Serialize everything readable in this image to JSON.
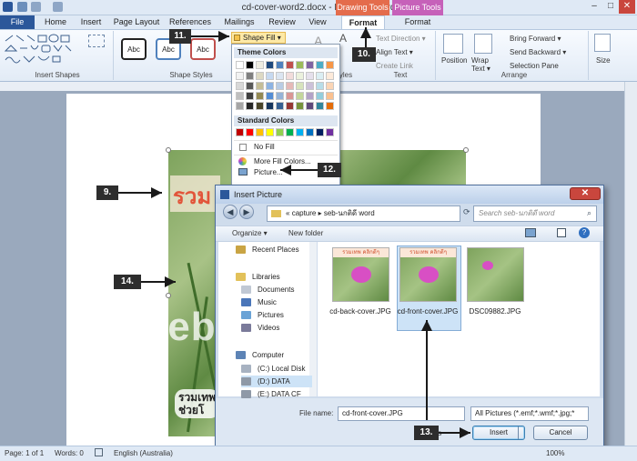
{
  "window": {
    "title": "cd-cover-word2.docx - Microsoft Word",
    "drawing_tools": "Drawing Tools",
    "picture_tools": "Picture Tools",
    "file_tab": "File",
    "tabs": [
      "Home",
      "Insert",
      "Page Layout",
      "References",
      "Mailings",
      "Review",
      "View"
    ],
    "format_tab_1": "Format",
    "format_tab_2": "Format"
  },
  "ribbon": {
    "shape_fill": "Shape Fill ▾",
    "text_direction": "Text Direction ▾",
    "align_text": "Align Text ▾",
    "create_link": "Create Link",
    "position": "Position",
    "wrap_text": "Wrap Text ▾",
    "bring_forward": "Bring Forward ▾",
    "send_backward": "Send Backward ▾",
    "selection_pane": "Selection Pane",
    "size": "Size",
    "abc": "Abc",
    "groups": {
      "insert_shapes": "Insert Shapes",
      "shape_styles": "Shape Styles",
      "text": "Text",
      "arrange": "Arrange",
      "styles_fragment": "yles"
    }
  },
  "fill_menu": {
    "theme_colors": "Theme Colors",
    "standard_colors": "Standard Colors",
    "no_fill": "No Fill",
    "more_fill_colors": "More Fill Colors...",
    "picture": "Picture..."
  },
  "document": {
    "thai_title": "รวม",
    "thai_title_right": "n",
    "caption_line1": "รวมเทพ",
    "caption_line2": "ช่วยโ",
    "watermark": "siamebook.com"
  },
  "dialog": {
    "title": "Insert Picture",
    "address_prefix": "«",
    "address_path": "capture  ▸  seb-นกติดี word",
    "search_placeholder": "Search seb-นกติดี word",
    "organize": "Organize ▾",
    "new_folder": "New folder",
    "nav": [
      {
        "label": "Recent Places",
        "icon_color": "#c9a444"
      },
      {
        "label": "Libraries",
        "icon_color": "#e2c15a"
      },
      {
        "label": "Documents",
        "icon_color": "#c0c8d4"
      },
      {
        "label": "Music",
        "icon_color": "#4a76b9"
      },
      {
        "label": "Pictures",
        "icon_color": "#6aa3d6"
      },
      {
        "label": "Videos",
        "icon_color": "#7a7a9a"
      },
      {
        "label": "Computer",
        "icon_color": "#5d83b5"
      },
      {
        "label": "(C:) Local Disk",
        "icon_color": "#a7b2c1"
      },
      {
        "label": "(D:) DATA",
        "icon_color": "#8f99a7"
      },
      {
        "label": "(E:) DATA CF",
        "icon_color": "#8f99a7"
      }
    ],
    "files": [
      {
        "name": "cd-back-cover.JPG",
        "thumb_title": "รวมเทพ คลิกดีๆ"
      },
      {
        "name": "cd-front-cover.JPG",
        "thumb_title": "รวมเทพ คลิกดีๆ"
      },
      {
        "name": "DSC09882.JPG",
        "thumb_title": ""
      }
    ],
    "file_name_label": "File name:",
    "file_name_value": "cd-front-cover.JPG",
    "file_type_value": "All Pictures (*.emf;*.wmf;*.jpg;*",
    "tools_fragment": "ols",
    "insert": "Insert",
    "cancel": "Cancel"
  },
  "callouts": {
    "c9": "9.",
    "c10": "10.",
    "c11": "11.",
    "c12": "12.",
    "c13": "13.",
    "c14": "14."
  },
  "status": {
    "page": "Page: 1 of 1",
    "words": "Words: 0",
    "language": "English (Australia)",
    "zoom": "100%"
  },
  "colors": {
    "file_tab": "#2b579a",
    "drawing_tools": "#e46c4c",
    "picture_tools": "#c661b9",
    "callout": "#2d2d2d",
    "selected_file": "#cde3f7"
  }
}
